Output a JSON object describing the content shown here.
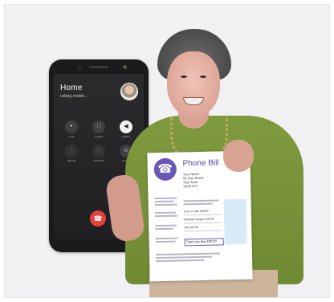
{
  "phone": {
    "caller_name": "Home",
    "call_status": "calling mobile...",
    "keys": [
      {
        "icon": "microphone-icon",
        "glyph": "•",
        "label": "mute",
        "state": "normal"
      },
      {
        "icon": "keypad-icon",
        "glyph": "∷",
        "label": "keypad",
        "state": "normal"
      },
      {
        "icon": "speaker-icon",
        "glyph": "◀",
        "label": "speaker",
        "state": "active"
      },
      {
        "icon": "add-call-icon",
        "glyph": "+",
        "label": "add call",
        "state": "dim"
      },
      {
        "icon": "facetime-icon",
        "glyph": "□",
        "label": "FaceTime",
        "state": "dim"
      },
      {
        "icon": "contacts-icon",
        "glyph": "☺",
        "label": "contacts",
        "state": "normal"
      }
    ],
    "end_call_glyph": "☎",
    "end_call_color": "#e5403b"
  },
  "bill": {
    "title": "Phone Bill",
    "logo_glyph": "☎",
    "brand_color": "#6b57b8",
    "address_lines": [
      "Your Name",
      "00 Your Street",
      "Your Town",
      "XX00 0YY"
    ],
    "amount_rows": [
      "Cost of calls £00.00",
      "Monthly charges £00.00",
      "VAT £00.00"
    ],
    "total": "Total now due £00.00"
  }
}
